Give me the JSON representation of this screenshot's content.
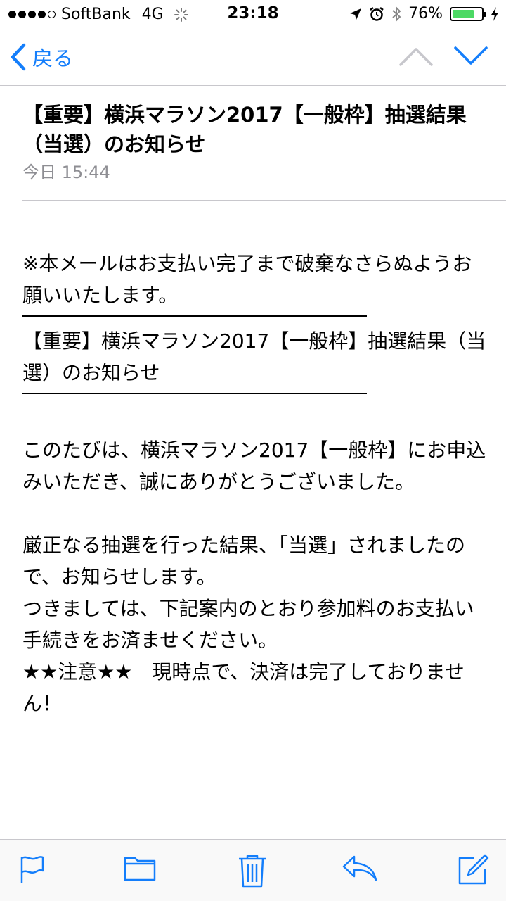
{
  "status_bar": {
    "carrier": "SoftBank",
    "network": "4G",
    "time": "23:18",
    "battery": "76%",
    "battery_level": 0.76
  },
  "nav": {
    "back_label": "戻る"
  },
  "email": {
    "subject": "【重要】横浜マラソン2017【一般枠】抽選結果（当選）のお知らせ",
    "date": "今日 15:44",
    "notice": "※本メールはお支払い完了まで破棄なさらぬようお願いいたします。",
    "title_repeat": "【重要】横浜マラソン2017【一般枠】抽選結果（当選）のお知らせ",
    "para1": "このたびは、横浜マラソン2017【一般枠】にお申込みいただき、誠にありがとうございました。",
    "para2_line1": "厳正なる抽選を行った結果、「当選」されましたので、お知らせします。",
    "para2_line2": "つきましては、下記案内のとおり参加料のお支払い手続きをお済ませください。",
    "para2_line3": "★★注意★★　現時点で、決済は完了しておりません！"
  },
  "colors": {
    "accent": "#147efb",
    "battery_green": "#4cd964",
    "divider": "#c8c7cc",
    "secondary_text": "#8e8e93"
  },
  "toolbar": {
    "icons": [
      "flag-icon",
      "folder-icon",
      "trash-icon",
      "reply-icon",
      "compose-icon"
    ]
  }
}
